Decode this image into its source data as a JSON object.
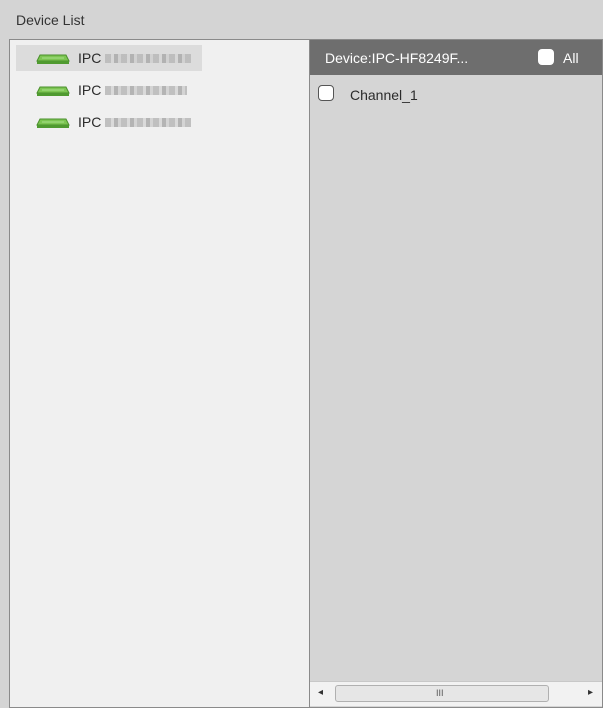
{
  "panel": {
    "title": "Device List"
  },
  "devices": [
    {
      "prefix": "IPC",
      "icon": "network-device-icon",
      "selected": true
    },
    {
      "prefix": "IPC",
      "icon": "network-device-icon",
      "selected": false
    },
    {
      "prefix": "IPC",
      "icon": "network-device-icon",
      "selected": false
    }
  ],
  "channel_panel": {
    "title": "Device:IPC-HF8249F...",
    "all_label": "All",
    "channels": [
      {
        "label": "Channel_1",
        "checked": false
      }
    ]
  },
  "scrollbar": {
    "left_arrow": "◂",
    "right_arrow": "▸",
    "grip": "III"
  },
  "colors": {
    "device_icon": "#6fbf4a",
    "header_bg": "#6e6e6e",
    "panel_bg": "#d4d4d4"
  }
}
